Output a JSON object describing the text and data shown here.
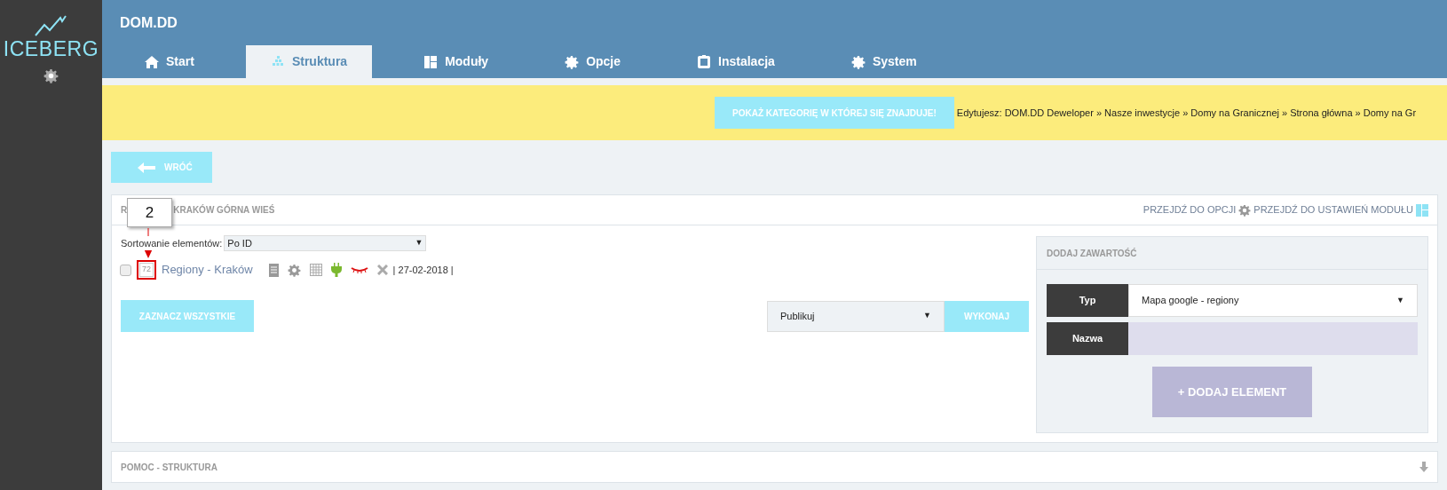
{
  "sidebar": {
    "logo": "ICEBERG"
  },
  "header": {
    "title": "DOM.DD"
  },
  "tabs": [
    {
      "label": "Start",
      "selected": false
    },
    {
      "label": "Struktura",
      "selected": true
    },
    {
      "label": "Moduły",
      "selected": false
    },
    {
      "label": "Opcje",
      "selected": false
    },
    {
      "label": "Instalacja",
      "selected": false
    },
    {
      "label": "System",
      "selected": false
    }
  ],
  "dropdown_arrow": "▼",
  "notice": {
    "button": "POKAŻ KATEGORIĘ W KTÓREJ SIĘ ZNAJDUJE!",
    "breadcrumb": "Edytujesz: DOM.DD Deweloper » Nasze inwestycje » Domy na Granicznej » Strona główna » Domy na Gr"
  },
  "back_button": "WRÓĆ",
  "panel": {
    "title_start": "R",
    "title_end": "KRAKÓW GÓRNA WIEŚ",
    "link_options": "PRZEJDŹ DO OPCJI",
    "link_module": "PRZEJDŹ DO USTAWIEŃ MODUŁU",
    "sort_label": "Sortowanie elementów:",
    "sort_value": "Po ID",
    "items": [
      {
        "checked": false,
        "id": "72",
        "name": "Regiony - Kraków",
        "date": "| 27-02-2018 |"
      }
    ],
    "select_all": "ZAZNACZ WSZYSTKIE",
    "action_value": "Publikuj",
    "action_button": "WYKONAJ"
  },
  "add_content": {
    "title": "DODAJ ZAWARTOŚĆ",
    "type_label": "Typ",
    "type_value": "Mapa google - regiony",
    "name_label": "Nazwa",
    "add_button": "+ DODAJ ELEMENT"
  },
  "help": {
    "title": "POMOC - STRUKTURA"
  },
  "callout": {
    "number": "2"
  }
}
